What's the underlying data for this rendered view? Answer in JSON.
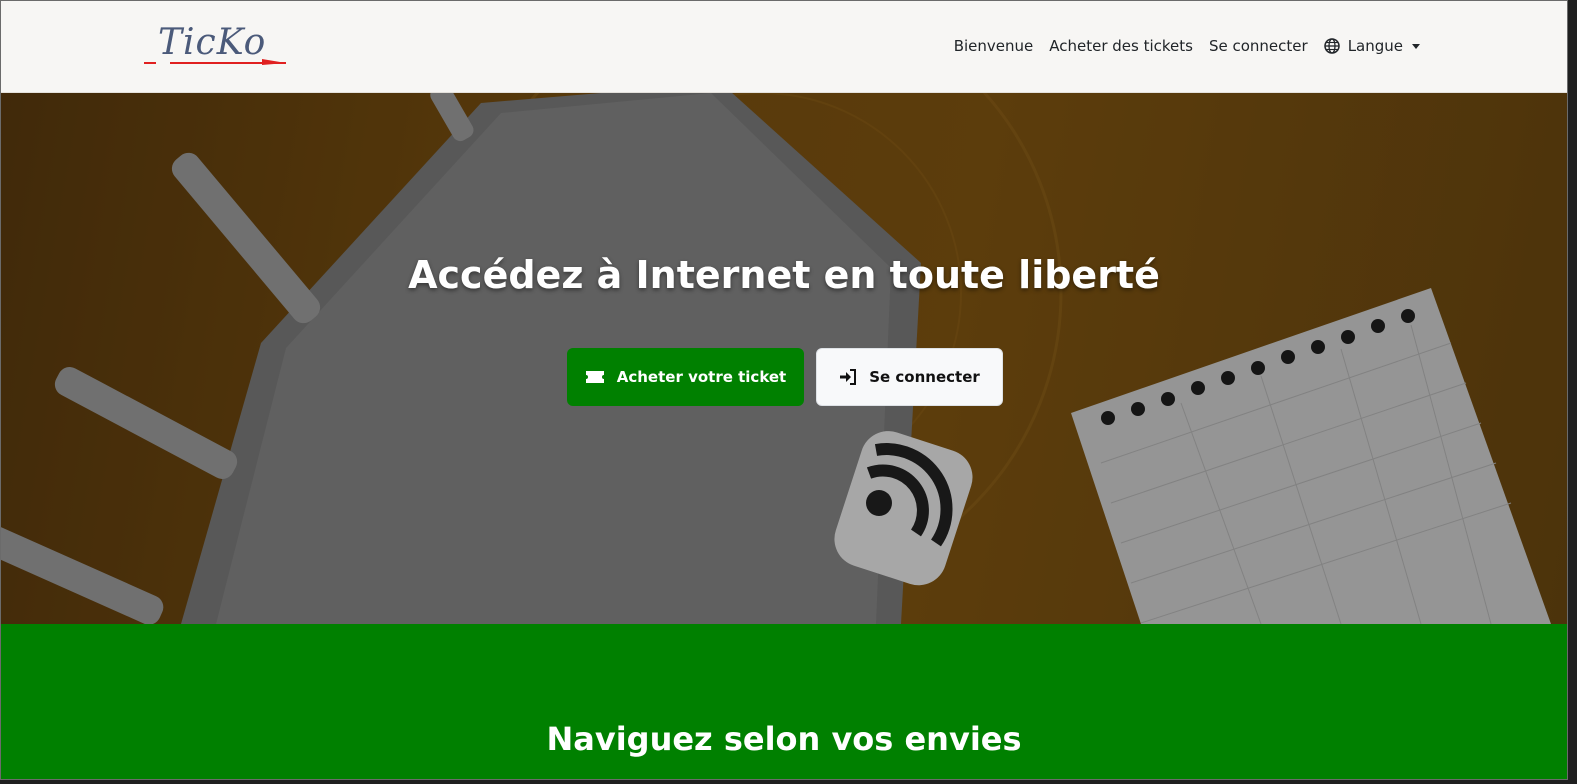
{
  "brand": {
    "logo_text": "TicKo"
  },
  "nav": {
    "links": [
      "Bienvenue",
      "Acheter des tickets",
      "Se connecter"
    ],
    "language_label": "Langue"
  },
  "hero": {
    "title": "Accédez à Internet en toute liberté",
    "buy_button": "Acheter votre ticket",
    "login_button": "Se connecter"
  },
  "section": {
    "title": "Naviguez selon vos envies"
  },
  "colors": {
    "primary_green": "#008000",
    "navbar_bg": "#f7f6f4",
    "hero_orange": "#805511",
    "logo_red": "#e02020",
    "logo_blue": "#4b5a7a"
  }
}
